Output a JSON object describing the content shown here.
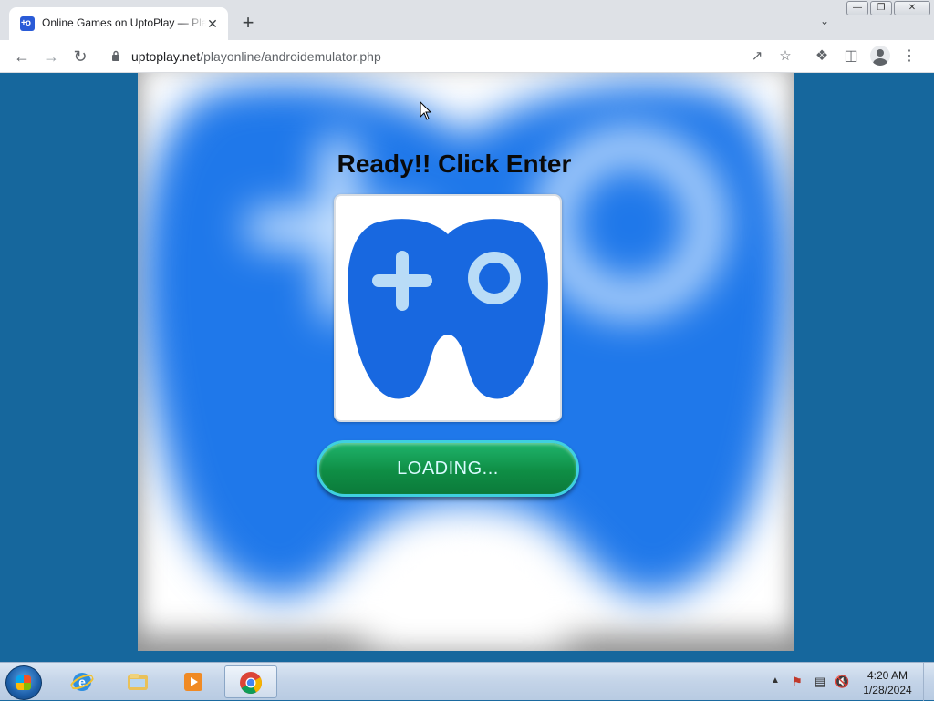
{
  "browser": {
    "tab": {
      "title": "Online Games on UptoPlay — Play",
      "favicon": "uptoplay-logo-icon"
    },
    "address": {
      "domain": "uptoplay.net",
      "path": "/playonline/androidemulator.php"
    }
  },
  "page": {
    "headline": "Ready!! Click Enter",
    "loading_button": "LOADING...",
    "brand_color": "#1a73e8",
    "accent_color": "#12994f"
  },
  "taskbar": {
    "time": "4:20 AM",
    "date": "1/28/2024",
    "apps": [
      "internet-explorer-icon",
      "file-explorer-icon",
      "media-player-icon",
      "chrome-icon"
    ]
  }
}
